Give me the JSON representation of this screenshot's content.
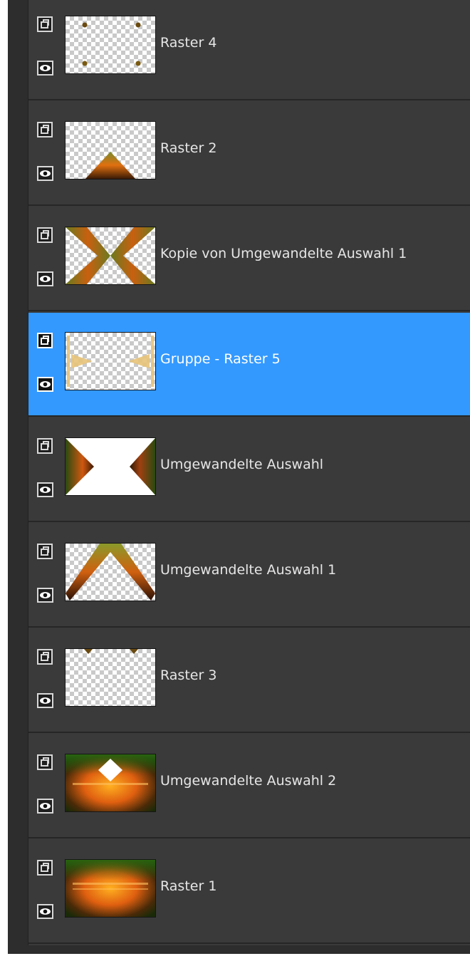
{
  "layers_panel": {
    "layers": [
      {
        "name": "Raster 4",
        "selected": false,
        "thumbnail": "corner-dots"
      },
      {
        "name": "Raster 2",
        "selected": false,
        "thumbnail": "triangle-bottom"
      },
      {
        "name": "Kopie von Umgewandelte Auswahl 1",
        "selected": false,
        "thumbnail": "butterfly"
      },
      {
        "name": "Gruppe - Raster 5",
        "selected": true,
        "thumbnail": "side-ornaments"
      },
      {
        "name": "Umgewandelte Auswahl",
        "selected": false,
        "thumbnail": "side-triangles"
      },
      {
        "name": "Umgewandelte Auswahl 1",
        "selected": false,
        "thumbnail": "chevron-up"
      },
      {
        "name": "Raster 3",
        "selected": false,
        "thumbnail": "top-marks"
      },
      {
        "name": "Umgewandelte Auswahl 2",
        "selected": false,
        "thumbnail": "gradient-with-diamond"
      },
      {
        "name": "Raster 1",
        "selected": false,
        "thumbnail": "gradient"
      }
    ],
    "icons": {
      "link": "layer-link-icon",
      "visibility": "eye-icon"
    },
    "colors": {
      "panel": "#3a3a3a",
      "selected": "#3399ff",
      "text": "#e6e6e6"
    }
  }
}
